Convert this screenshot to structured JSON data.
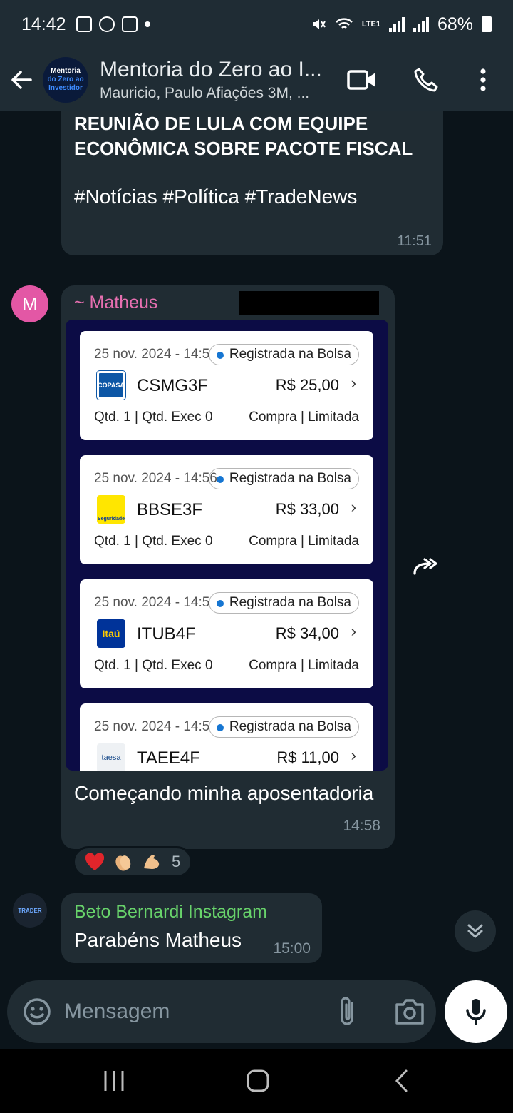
{
  "status_bar": {
    "time": "14:42",
    "battery": "68%",
    "network": "LTE1"
  },
  "header": {
    "group_avatar_lines": [
      "Mentoria",
      "do Zero ao",
      "Investidor"
    ],
    "title": "Mentoria do Zero ao I...",
    "subtitle": "Mauricio, Paulo Afiações 3M, ..."
  },
  "messages": {
    "news": {
      "headline": "REUNIÃO DE LULA COM EQUIPE ECONÔMICA SOBRE PACOTE FISCAL",
      "tags": "#Notícias #Política #TradeNews",
      "time": "11:51"
    },
    "matheus": {
      "avatar_letter": "M",
      "sender": "~ Matheus",
      "caption": "Começando minha aposentadoria",
      "time": "14:58",
      "reactions": {
        "count": "5"
      },
      "orders": [
        {
          "date": "25 nov. 2024 - 14:5",
          "status": "Registrada na Bolsa",
          "logo": "COPASA",
          "ticker": "CSMG3F",
          "price": "R$ 25,00",
          "qty": "Qtd. 1 | Qtd. Exec 0",
          "kind": "Compra | Limitada"
        },
        {
          "date": "25 nov. 2024 - 14:56",
          "status": "Registrada na Bolsa",
          "logo": "Seguridade",
          "ticker": "BBSE3F",
          "price": "R$ 33,00",
          "qty": "Qtd. 1 | Qtd. Exec 0",
          "kind": "Compra | Limitada"
        },
        {
          "date": "25 nov. 2024 - 14:5",
          "status": "Registrada na Bolsa",
          "logo": "Itaú",
          "ticker": "ITUB4F",
          "price": "R$ 34,00",
          "qty": "Qtd. 1 | Qtd. Exec 0",
          "kind": "Compra | Limitada"
        },
        {
          "date": "25 nov. 2024 - 14:5",
          "status": "Registrada na Bolsa",
          "logo": "taesa",
          "ticker": "TAEE4F",
          "price": "R$ 11,00",
          "qty": "",
          "kind": ""
        }
      ]
    },
    "beto": {
      "sender": "Beto Bernardi Instagram",
      "text": "Parabéns Matheus",
      "time": "15:00",
      "avatar_text": "TRADER"
    }
  },
  "input": {
    "placeholder": "Mensagem"
  },
  "colors": {
    "bubble": "#202c33",
    "background": "#0b141a",
    "accent_pink": "#e66fb0",
    "accent_green": "#68d36b"
  }
}
